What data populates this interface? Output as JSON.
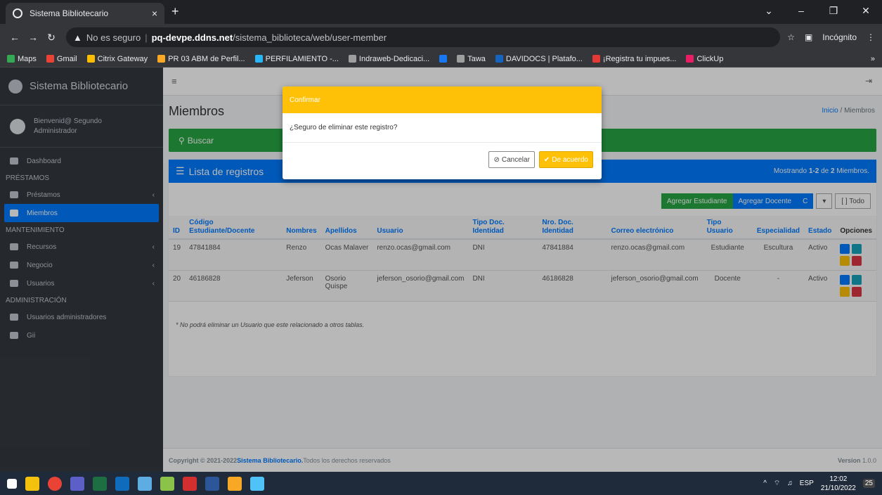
{
  "browser": {
    "tab_title": "Sistema Bibliotecario",
    "new_tab": "+",
    "insecure": "No es seguro",
    "url_host": "pq-devpe.ddns.net",
    "url_path": "/sistema_biblioteca/web/user-member",
    "incognito": "Incógnito",
    "bookmarks": [
      {
        "label": "Maps",
        "color": "#34a853"
      },
      {
        "label": "Gmail",
        "color": "#ea4335"
      },
      {
        "label": "Citrix Gateway",
        "color": "#fbbc04"
      },
      {
        "label": "PR 03 ABM de Perfil...",
        "color": "#f9a825"
      },
      {
        "label": "PERFILAMIENTO -...",
        "color": "#29b6f6"
      },
      {
        "label": "Indraweb-Dedicaci...",
        "color": "#9e9e9e"
      },
      {
        "label": "",
        "color": "#1877f2"
      },
      {
        "label": "Tawa",
        "color": "#9e9e9e"
      },
      {
        "label": "DAVIDOCS | Platafo...",
        "color": "#1565c0"
      },
      {
        "label": "¡Registra tu impues...",
        "color": "#e53935"
      },
      {
        "label": "ClickUp",
        "color": "#e91e63"
      }
    ],
    "more": "»"
  },
  "sidebar": {
    "brand": "Sistema Bibliotecario",
    "user_line1": "Bienvenid@ Segundo",
    "user_line2": "Administrador",
    "items": [
      {
        "type": "item",
        "label": "Dashboard"
      },
      {
        "type": "head",
        "label": "PRÉSTAMOS"
      },
      {
        "type": "item",
        "label": "Préstamos",
        "chev": "‹"
      },
      {
        "type": "active",
        "label": "Miembros"
      },
      {
        "type": "head",
        "label": "MANTENIMIENTO"
      },
      {
        "type": "item",
        "label": "Recursos",
        "chev": "‹"
      },
      {
        "type": "item",
        "label": "Negocio",
        "chev": "‹"
      },
      {
        "type": "item",
        "label": "Usuarios",
        "chev": "‹"
      },
      {
        "type": "head",
        "label": "ADMINISTRACIÓN"
      },
      {
        "type": "item",
        "label": "Usuarios administradores"
      },
      {
        "type": "item",
        "label": "Gii"
      }
    ]
  },
  "page": {
    "title": "Miembros",
    "breadcrumb_home": "Inicio",
    "breadcrumb_sep": " / ",
    "breadcrumb_current": "Miembros",
    "search": "Buscar",
    "list_title": "Lista de registros",
    "count_prefix": "Mostrando ",
    "count_bold": "1-2",
    "count_mid": " de ",
    "count_total": "2",
    "count_suffix": " Miembros.",
    "btn_add_student": "Agregar Estudiante",
    "btn_add_teacher": "Agregar Docente",
    "btn_refresh": "C",
    "btn_toggle": "▾",
    "btn_all": "[ ] Todo",
    "note": "* No podrá eliminar un Usuario que este relacionado a otros tablas."
  },
  "table": {
    "headers": [
      "ID",
      "Código Estudiante/Docente",
      "Nombres",
      "Apellidos",
      "Usuario",
      "Tipo Doc. Identidad",
      "Nro. Doc. Identidad",
      "Correo electrónico",
      "Tipo Usuario",
      "Especialidad",
      "Estado",
      "Opciones"
    ],
    "rows": [
      [
        "19",
        "47841884",
        "Renzo",
        "Ocas Malaver",
        "renzo.ocas@gmail.com",
        "DNI",
        "47841884",
        "renzo.ocas@gmail.com",
        "Estudiante",
        "Escultura",
        "Activo"
      ],
      [
        "20",
        "46186828",
        "Jeferson",
        "Osorio Quispe",
        "jeferson_osorio@gmail.com",
        "DNI",
        "46186828",
        "jeferson_osorio@gmail.com",
        "Docente",
        "-",
        "Activo"
      ]
    ]
  },
  "footer": {
    "copyright": "Copyright © 2021-2022 ",
    "brand": "Sistema Bibliotecario.",
    "rights": " Todos los derechos reservados",
    "version_label": "Version",
    "version": " 1.0.0"
  },
  "modal": {
    "title": "Confirmar",
    "message": "¿Seguro de eliminar este registro?",
    "cancel": "Cancelar",
    "ok": "De acuerdo"
  },
  "taskbar": {
    "time": "12:02",
    "date": "21/10/2022",
    "lang": "ESP",
    "notif": "25"
  }
}
